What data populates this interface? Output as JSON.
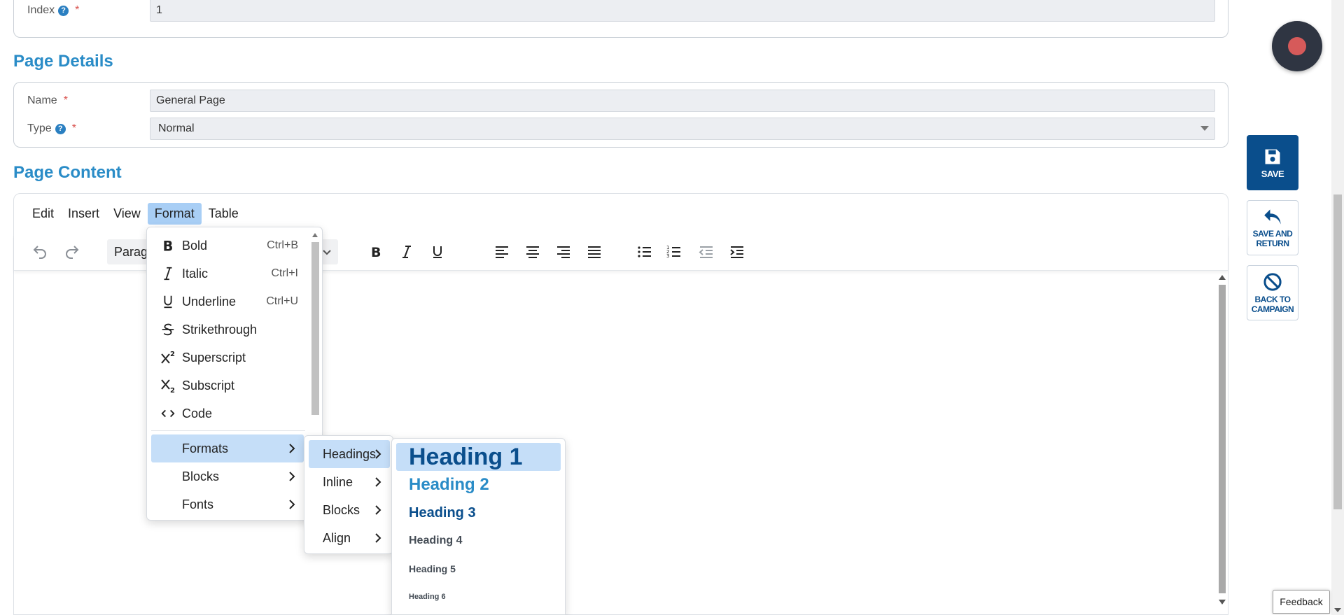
{
  "campaign_section": {
    "index_label": "Index",
    "index_value": "1"
  },
  "page_details": {
    "title": "Page Details",
    "name_label": "Name",
    "name_value": "General Page",
    "type_label": "Type",
    "type_value": "Normal"
  },
  "page_content": {
    "title": "Page Content",
    "menubar": [
      "Edit",
      "Insert",
      "View",
      "Format",
      "Table"
    ],
    "block_format": "Paragraph"
  },
  "format_menu": {
    "items": [
      {
        "label": "Bold",
        "shortcut": "Ctrl+B",
        "icon": "bold-icon"
      },
      {
        "label": "Italic",
        "shortcut": "Ctrl+I",
        "icon": "italic-icon"
      },
      {
        "label": "Underline",
        "shortcut": "Ctrl+U",
        "icon": "underline-icon"
      },
      {
        "label": "Strikethrough",
        "shortcut": "",
        "icon": "strikethrough-icon"
      },
      {
        "label": "Superscript",
        "shortcut": "",
        "icon": "superscript-icon"
      },
      {
        "label": "Subscript",
        "shortcut": "",
        "icon": "subscript-icon"
      },
      {
        "label": "Code",
        "shortcut": "",
        "icon": "code-icon"
      }
    ],
    "submenus": [
      "Formats",
      "Blocks",
      "Fonts"
    ]
  },
  "formats_menu": {
    "items": [
      "Headings",
      "Inline",
      "Blocks",
      "Align"
    ]
  },
  "headings_menu": {
    "items": [
      "Heading 1",
      "Heading 2",
      "Heading 3",
      "Heading 4",
      "Heading 5",
      "Heading 6"
    ]
  },
  "side_actions": {
    "save": "SAVE",
    "save_and_return_1": "SAVE AND",
    "save_and_return_2": "RETURN",
    "back_1": "BACK TO",
    "back_2": "CAMPAIGN"
  },
  "feedback_label": "Feedback",
  "colors": {
    "accent": "#2a8cc7",
    "primary": "#0a4e8c",
    "menu_highlight": "#c5def8",
    "required": "#d9534f"
  }
}
